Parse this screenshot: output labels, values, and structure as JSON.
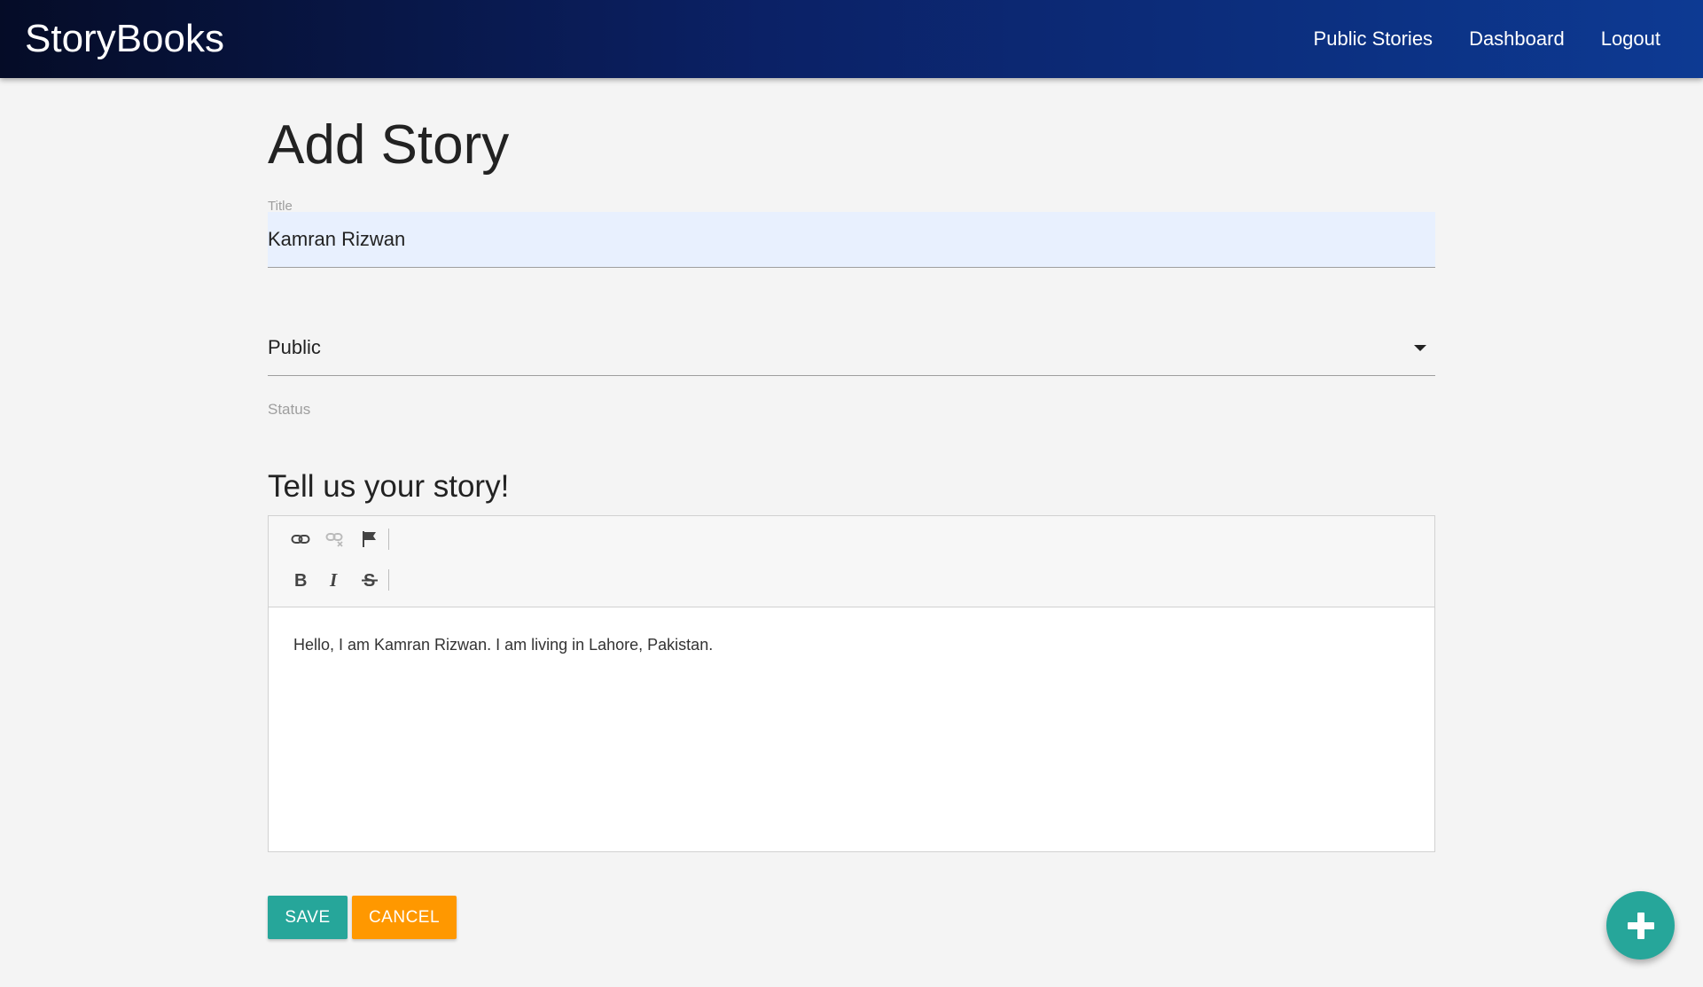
{
  "navbar": {
    "brand": "StoryBooks",
    "links": [
      "Public Stories",
      "Dashboard",
      "Logout"
    ]
  },
  "page": {
    "title": "Add Story"
  },
  "form": {
    "title_label": "Title",
    "title_value": "Kamran Rizwan",
    "status_value": "Public",
    "status_label": "Status",
    "editor_heading": "Tell us your story!",
    "editor_toolbar": {
      "row1": [
        "link-icon",
        "unlink-icon",
        "flag-icon"
      ],
      "row2": [
        "bold-icon",
        "italic-icon",
        "strikethrough-icon"
      ]
    },
    "editor_content": "Hello, I am Kamran Rizwan. I am living in Lahore, Pakistan."
  },
  "buttons": {
    "save": "Save",
    "cancel": "Cancel",
    "fab_icon": "plus-icon"
  },
  "colors": {
    "navbar_start": "#050c27",
    "navbar_end": "#0d3a93",
    "teal": "#26a69a",
    "orange": "#ff9800",
    "input_bg": "#e8f0fe"
  }
}
